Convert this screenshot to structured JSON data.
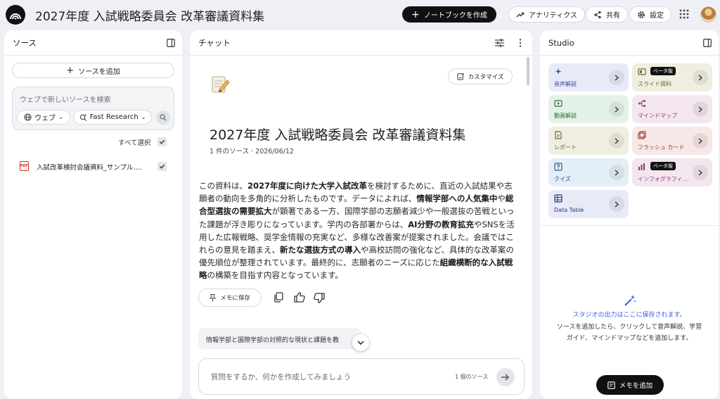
{
  "header": {
    "title": "2027年度 入試戦略委員会 改革審議資料集",
    "new_notebook": "ノートブックを作成",
    "analytics": "アナリティクス",
    "share": "共有",
    "settings": "設定"
  },
  "sources": {
    "title": "ソース",
    "add_source": "ソースを追加",
    "search_placeholder": "ウェブで新しいソースを検索",
    "web_option": "ウェブ",
    "research_option": "Fast Research",
    "select_all": "すべて選択",
    "items": [
      {
        "label": "入試改革検討会議資料_サンプル...."
      }
    ]
  },
  "chat": {
    "title": "チャット",
    "customize": "カスタマイズ",
    "notebook_title": "2027年度 入試戦略委員会 改革審議資料集",
    "meta": "1 件のソース · 2026/06/12",
    "summary": [
      {
        "t": "この資料は、"
      },
      {
        "t": "2027年度に向けた大学入試改革",
        "b": true
      },
      {
        "t": "を検討するために、直近の入試結果や志願者の動向を多角的に分析したものです。データによれば、"
      },
      {
        "t": "情報学部への人気集中",
        "b": true
      },
      {
        "t": "や"
      },
      {
        "t": "総合型選抜の需要拡大",
        "b": true
      },
      {
        "t": "が顕著である一方、国際学部の志願者減少や一般選抜の苦戦といった課題が浮き彫りになっています。学内の各部署からは、"
      },
      {
        "t": "AI分野の教育拡充",
        "b": true
      },
      {
        "t": "やSNSを活用した広報戦略、奨学金情報の充実など、多様な改善案が提案されました。会議ではこれらの意見を踏まえ、"
      },
      {
        "t": "新たな選抜方式の導入",
        "b": true
      },
      {
        "t": "や高校訪問の強化など、具体的な改革案の優先順位が整理されています。最終的に、志願者のニーズに応じた"
      },
      {
        "t": "組織横断的な入試戦略",
        "b": true
      },
      {
        "t": "の構築を目指す内容となっています。"
      }
    ],
    "save_note": "メモに保存",
    "suggestion": "情報学部と国際学部の対照的な現状と課題を教",
    "input_placeholder": "質問をするか、何かを作成してみましょう",
    "source_count": "1 個のソース"
  },
  "studio": {
    "title": "Studio",
    "tiles": [
      {
        "label": "音声解説",
        "bg": "#e8eaf8",
        "fg": "#3f4a9a",
        "icon": "audio-overview-icon"
      },
      {
        "label": "スライド資料",
        "bg": "#efeee0",
        "fg": "#6e6a3c",
        "icon": "slides-icon",
        "badge": "ベータ版"
      },
      {
        "label": "動画解説",
        "bg": "#e3f1e6",
        "fg": "#2f6b3d",
        "icon": "video-overview-icon"
      },
      {
        "label": "マインドマップ",
        "bg": "#f3e6ef",
        "fg": "#8a3d6e",
        "icon": "mind-map-icon"
      },
      {
        "label": "レポート",
        "bg": "#efeee0",
        "fg": "#6e6a3c",
        "icon": "report-icon"
      },
      {
        "label": "フラッシュ カード",
        "bg": "#f7e7e7",
        "fg": "#9a3c3c",
        "icon": "flashcards-icon"
      },
      {
        "label": "クイズ",
        "bg": "#e3eef7",
        "fg": "#2e5a88",
        "icon": "quiz-icon"
      },
      {
        "label": "インフォグラフィ...",
        "bg": "#f3e6ef",
        "fg": "#8a3d6e",
        "icon": "infographic-icon",
        "badge": "ベータ版"
      },
      {
        "label": "Data Table",
        "bg": "#e8eaf8",
        "fg": "#2d3a7a",
        "icon": "data-table-icon"
      }
    ],
    "empty_title": "スタジオの出力はここに保存されます。",
    "empty_desc_1": "ソースを追加したら、クリックして音声解説、学習",
    "empty_desc_2": "ガイド、マインドマップなどを追加します。",
    "add_note": "メモを追加"
  }
}
